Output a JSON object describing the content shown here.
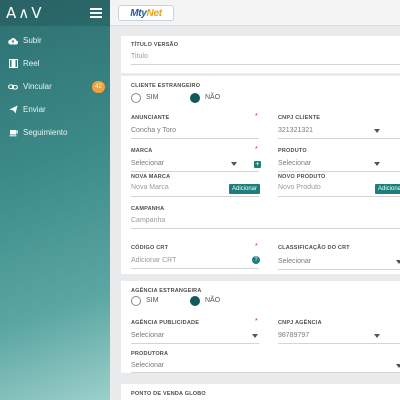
{
  "app": {
    "logo": "A∧V",
    "brand_part1": "Mty",
    "brand_part2": "Net"
  },
  "sidebar": {
    "items": [
      {
        "label": "Subir",
        "icon": "cloud-upload-icon"
      },
      {
        "label": "Reel",
        "icon": "film-icon"
      },
      {
        "label": "Vincular",
        "icon": "link-icon",
        "badge": "42"
      },
      {
        "label": "Enviar",
        "icon": "send-icon"
      },
      {
        "label": "Seguimiento",
        "icon": "tracking-icon"
      }
    ]
  },
  "form": {
    "titulo_version": {
      "label": "Título Versão",
      "placeholder": "Titulo"
    },
    "cliente_estrangeiro": {
      "label": "Cliente Estrangeiro",
      "sim": "SIM",
      "nao": "NÃO",
      "selected": "NÃO"
    },
    "anunciante": {
      "label": "Anunciante",
      "value": "Concha y Toro"
    },
    "cnpj_cliente": {
      "label": "CNPJ Cliente",
      "value": "321321321"
    },
    "marca": {
      "label": "Marca",
      "value": "Selecionar"
    },
    "produto": {
      "label": "Produto",
      "value": "Selecionar"
    },
    "nova_marca": {
      "label": "Nova Marca",
      "placeholder": "Nova Marca",
      "button": "Adicionar"
    },
    "novo_produto": {
      "label": "Novo Produto",
      "placeholder": "Novo Produto",
      "button": "Adicionar"
    },
    "campanha": {
      "label": "Campanha",
      "placeholder": "Campanha"
    },
    "codigo_crt": {
      "label": "Código CRT",
      "placeholder": "Adicionar CRT",
      "help": "?"
    },
    "classificacao_crt": {
      "label": "Classificação do CRT",
      "value": "Selecionar"
    },
    "agencia_estrangeira": {
      "label": "Agência Estrangeira",
      "sim": "SIM",
      "nao": "NÃO",
      "selected": "NÃO"
    },
    "agencia_publicidade": {
      "label": "Agência Publicidade",
      "value": "Selecionar"
    },
    "cnpj_agencia": {
      "label": "CNPJ Agência",
      "value": "98789797"
    },
    "produtora": {
      "label": "Produtora",
      "value": "Selecionar"
    },
    "ponto_venda": {
      "label": "Ponto de Venda Globo"
    },
    "required_mark": "*",
    "plus": "+"
  }
}
